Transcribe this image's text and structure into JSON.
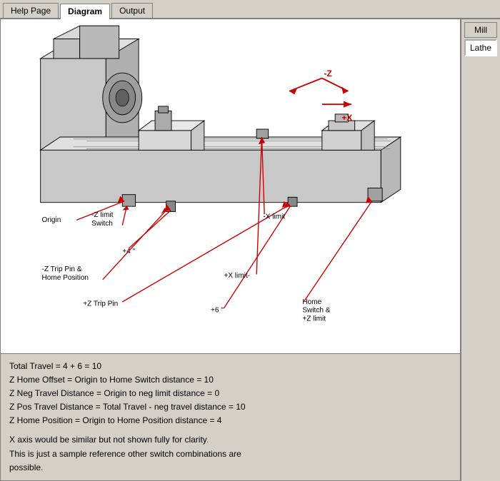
{
  "tabs": [
    {
      "label": "Help Page",
      "active": false
    },
    {
      "label": "Diagram",
      "active": true
    },
    {
      "label": "Output",
      "active": false
    }
  ],
  "right_buttons": [
    {
      "label": "Mill",
      "active": false
    },
    {
      "label": "Lathe",
      "active": true
    }
  ],
  "info_lines": [
    "Total Travel = 4 + 6 = 10",
    "Z Home Offset = Origin to Home Switch distance = 10",
    "Z Neg Travel Distance = Origin to neg limit distance = 0",
    "Z Pos Travel Distance = Total Travel - neg travel distance = 10",
    "Z Home Position = Origin to Home Position distance = 4",
    "",
    "X axis would be similar but not shown fully for clarity.",
    "This is just a sample reference other switch combinations are",
    "possible."
  ],
  "diagram_labels": {
    "neg_z": "-Z",
    "pos_x": "+X",
    "neg_z_limit_switch": "-Z limit\nSwitch",
    "origin": "Origin",
    "plus_4": "+4 \"",
    "neg_z_trip": "-Z Trip Pin &\nHome Position",
    "plus_z_trip_pin": "+Z Trip Pin",
    "plus_6": "+6 \"",
    "neg_x_limit": "-X limit",
    "plus_x_limit": "+X limit",
    "home_switch_z_limit": "Home\nSwitch &\n+Z limit",
    "plus_z_limit": "+Z limit"
  }
}
